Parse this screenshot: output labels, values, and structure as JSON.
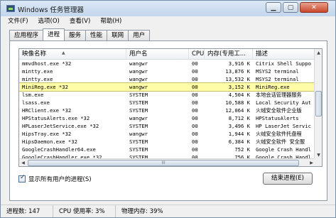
{
  "window": {
    "title": "Windows 任务管理器"
  },
  "menu": [
    "文件(F)",
    "选项(O)",
    "查看(V)",
    "帮助(H)"
  ],
  "tabs": [
    "应用程序",
    "进程",
    "服务",
    "性能",
    "联网",
    "用户"
  ],
  "active_tab": "进程",
  "columns": [
    "映像名称",
    "用户名",
    "CPU",
    "内存(专用工...",
    "描述"
  ],
  "rows": [
    {
      "name": "mmvdhost.exe *32",
      "user": "wangwr",
      "cpu": "00",
      "mem": "3,916 K",
      "desc": "Citrix Shell Suppo"
    },
    {
      "name": "mintty.exe",
      "user": "wangwr",
      "cpu": "00",
      "mem": "13,876 K",
      "desc": "MSYS2 terminal"
    },
    {
      "name": "mintty.exe",
      "user": "wangwr",
      "cpu": "00",
      "mem": "13,532 K",
      "desc": "MSYS2 terminal"
    },
    {
      "name": "MiniReg.exe *32",
      "user": "wangwr",
      "cpu": "00",
      "mem": "3,152 K",
      "desc": "MiniReg.exe",
      "selected": true
    },
    {
      "name": "lsm.exe",
      "user": "SYSTEM",
      "cpu": "00",
      "mem": "4,504 K",
      "desc": "本地会话管理器服务"
    },
    {
      "name": "lsass.exe",
      "user": "SYSTEM",
      "cpu": "00",
      "mem": "10,588 K",
      "desc": "Local Security Aut"
    },
    {
      "name": "HRClient.exe *32",
      "user": "SYSTEM",
      "cpu": "00",
      "mem": "12,064 K",
      "desc": "火绒安全软件企业版"
    },
    {
      "name": "HPStatusAlerts.exe *32",
      "user": "wangwr",
      "cpu": "00",
      "mem": "8,712 K",
      "desc": "HPStatusAlerts"
    },
    {
      "name": "HPLaserJetService.exe *32",
      "user": "SYSTEM",
      "cpu": "00",
      "mem": "3,496 K",
      "desc": "HP LaserJet Servic"
    },
    {
      "name": "HipsTray.exe *32",
      "user": "wangwr",
      "cpu": "00",
      "mem": "1,944 K",
      "desc": "火绒安全软件托盘程"
    },
    {
      "name": "HipsDaemon.exe *32",
      "user": "SYSTEM",
      "cpu": "00",
      "mem": "6,384 K",
      "desc": "火绒安全软件 安全服"
    },
    {
      "name": "GoogleCrashHandler64.exe",
      "user": "SYSTEM",
      "cpu": "00",
      "mem": "752 K",
      "desc": "Google Crash Handl"
    },
    {
      "name": "GoogleCrashHandler.exe *32",
      "user": "SYSTEM",
      "cpu": "00",
      "mem": "756 K",
      "desc": "Google Crash Handl"
    }
  ],
  "hscroll_label": "III",
  "show_all_label": "显示所有用户的进程(S)",
  "end_process_label": "结束进程(E)",
  "status": {
    "processes": "进程数: 147",
    "cpu": "CPU 使用率: 3%",
    "memory": "物理内存: 39%"
  }
}
